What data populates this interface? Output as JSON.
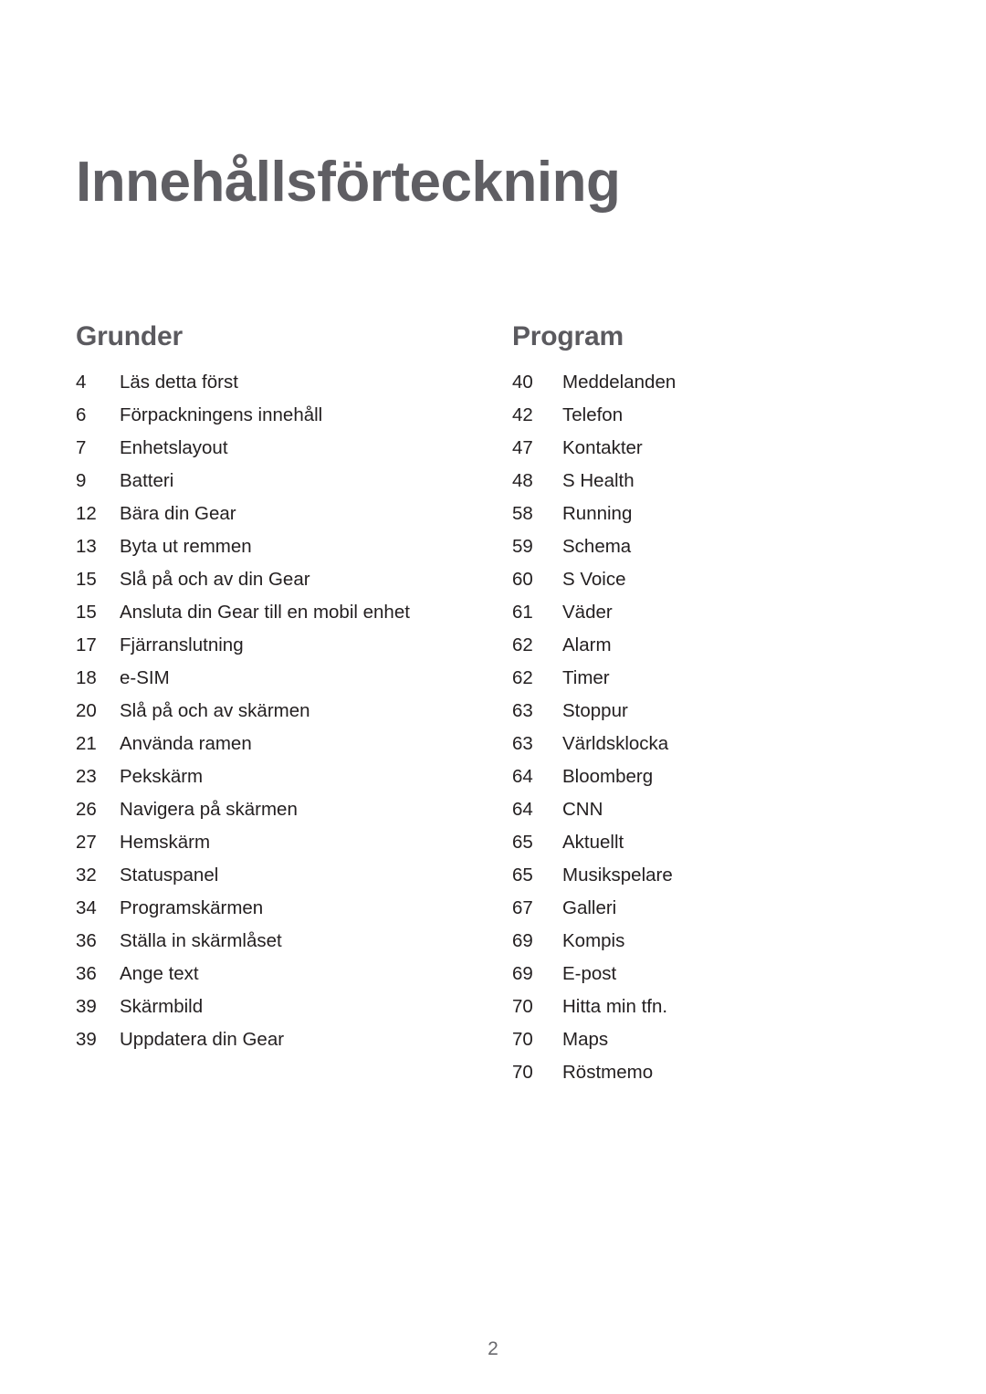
{
  "document": {
    "title": "Innehållsförteckning",
    "page_number": "2"
  },
  "colors": {
    "title": "#5f5e63",
    "heading": "#5b5a5f",
    "body": "#231f20",
    "page_number": "#6a6a6e",
    "background": "#ffffff"
  },
  "sections": [
    {
      "heading": "Grunder",
      "entries": [
        {
          "page": "4",
          "label": "Läs detta först"
        },
        {
          "page": "6",
          "label": "Förpackningens innehåll"
        },
        {
          "page": "7",
          "label": "Enhetslayout"
        },
        {
          "page": "9",
          "label": "Batteri"
        },
        {
          "page": "12",
          "label": "Bära din Gear"
        },
        {
          "page": "13",
          "label": "Byta ut remmen"
        },
        {
          "page": "15",
          "label": "Slå på och av din Gear"
        },
        {
          "page": "15",
          "label": "Ansluta din Gear till en mobil enhet"
        },
        {
          "page": "17",
          "label": "Fjärranslutning"
        },
        {
          "page": "18",
          "label": "e-SIM"
        },
        {
          "page": "20",
          "label": "Slå på och av skärmen"
        },
        {
          "page": "21",
          "label": "Använda ramen"
        },
        {
          "page": "23",
          "label": "Pekskärm"
        },
        {
          "page": "26",
          "label": "Navigera på skärmen"
        },
        {
          "page": "27",
          "label": "Hemskärm"
        },
        {
          "page": "32",
          "label": "Statuspanel"
        },
        {
          "page": "34",
          "label": "Programskärmen"
        },
        {
          "page": "36",
          "label": "Ställa in skärmlåset"
        },
        {
          "page": "36",
          "label": "Ange text"
        },
        {
          "page": "39",
          "label": "Skärmbild"
        },
        {
          "page": "39",
          "label": "Uppdatera din Gear"
        }
      ]
    },
    {
      "heading": "Program",
      "entries": [
        {
          "page": "40",
          "label": "Meddelanden"
        },
        {
          "page": "42",
          "label": "Telefon"
        },
        {
          "page": "47",
          "label": "Kontakter"
        },
        {
          "page": "48",
          "label": "S Health"
        },
        {
          "page": "58",
          "label": "Running"
        },
        {
          "page": "59",
          "label": "Schema"
        },
        {
          "page": "60",
          "label": "S Voice"
        },
        {
          "page": "61",
          "label": "Väder"
        },
        {
          "page": "62",
          "label": "Alarm"
        },
        {
          "page": "62",
          "label": "Timer"
        },
        {
          "page": "63",
          "label": "Stoppur"
        },
        {
          "page": "63",
          "label": "Världsklocka"
        },
        {
          "page": "64",
          "label": "Bloomberg"
        },
        {
          "page": "64",
          "label": "CNN"
        },
        {
          "page": "65",
          "label": "Aktuellt"
        },
        {
          "page": "65",
          "label": "Musikspelare"
        },
        {
          "page": "67",
          "label": "Galleri"
        },
        {
          "page": "69",
          "label": "Kompis"
        },
        {
          "page": "69",
          "label": "E-post"
        },
        {
          "page": "70",
          "label": "Hitta min tfn."
        },
        {
          "page": "70",
          "label": "Maps"
        },
        {
          "page": "70",
          "label": "Röstmemo"
        }
      ]
    }
  ]
}
